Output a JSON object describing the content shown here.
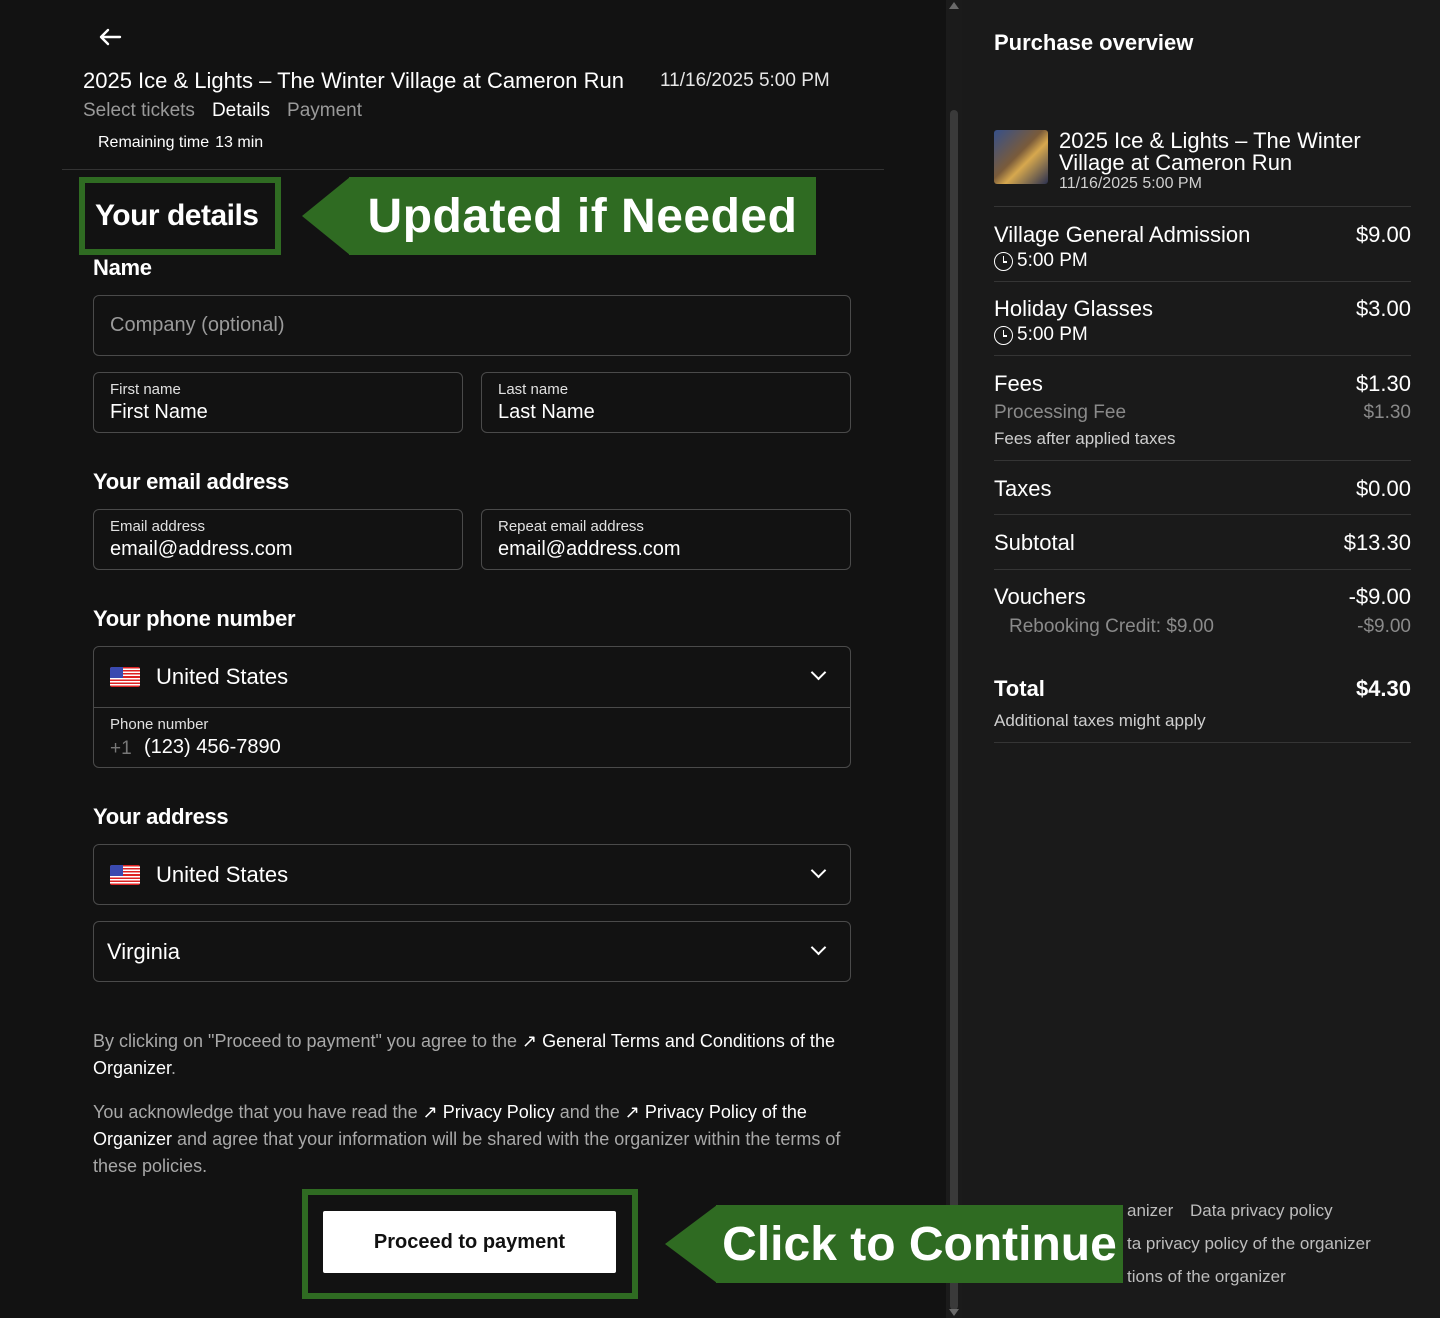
{
  "header": {
    "event_title": "2025 Ice & Lights – The Winter Village at Cameron Run",
    "event_date": "11/16/2025 5:00 PM",
    "steps": [
      "Select tickets",
      "Details",
      "Payment"
    ],
    "remaining_label": "Remaining time",
    "remaining_value": "13 min"
  },
  "annotations": {
    "your_details": "Your details",
    "updated_if_needed": "Updated if Needed",
    "click_to_continue": "Click to Continue",
    "accent_color": "#2f6b22"
  },
  "form": {
    "name_label": "Name",
    "company_placeholder": "Company (optional)",
    "first_name_label": "First name",
    "first_name_value": "First Name",
    "last_name_label": "Last name",
    "last_name_value": "Last Name",
    "email_section": "Your email address",
    "email_label": "Email address",
    "email_value": "email@address.com",
    "repeat_email_label": "Repeat email address",
    "repeat_email_value": "email@address.com",
    "phone_section": "Your phone number",
    "phone_country": "United States",
    "phone_label": "Phone number",
    "phone_prefix": "+1",
    "phone_value": "(123) 456-7890",
    "address_section": "Your address",
    "address_country": "United States",
    "address_state": "Virginia"
  },
  "legal": {
    "p1_a": "By clicking on \"Proceed to payment\" you agree to the ",
    "p1_link": "General Terms and Conditions of the Organizer",
    "p1_end": ".",
    "p2_a": "You acknowledge that you have read the ",
    "p2_link1": "Privacy Policy",
    "p2_b": " and the ",
    "p2_link2": "Privacy Policy of the Organizer",
    "p2_c": " and agree that your information will be shared with the organizer within the terms of these policies."
  },
  "proceed_label": "Proceed to payment",
  "overview": {
    "title": "Purchase overview",
    "event_name": "2025 Ice & Lights – The Winter Village at Cameron Run",
    "event_date": "11/16/2025 5:00 PM",
    "items": [
      {
        "name": "Village General Admission",
        "price": "$9.00",
        "time": "5:00 PM"
      },
      {
        "name": "Holiday Glasses",
        "price": "$3.00",
        "time": "5:00 PM"
      }
    ],
    "fees_label": "Fees",
    "fees_price": "$1.30",
    "processing_label": "Processing Fee",
    "processing_price": "$1.30",
    "fees_note": "Fees after applied taxes",
    "taxes_label": "Taxes",
    "taxes_price": "$0.00",
    "subtotal_label": "Subtotal",
    "subtotal_price": "$13.30",
    "vouchers_label": "Vouchers",
    "vouchers_price": "-$9.00",
    "rebooking_label": "Rebooking Credit: $9.00",
    "rebooking_price": "-$9.00",
    "total_label": "Total",
    "total_price": "$4.30",
    "total_note": "Additional taxes might apply",
    "footer": {
      "f1a": "anizer",
      "f1b": "Data privacy policy",
      "f2": "ta privacy policy of the organizer",
      "f3": "tions of the organizer"
    }
  }
}
